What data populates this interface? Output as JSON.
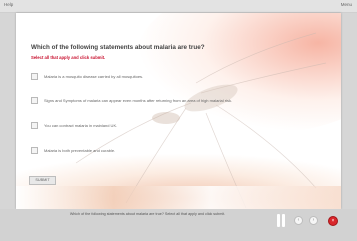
{
  "topbar": {
    "help": "Help",
    "menu": "Menu"
  },
  "quiz": {
    "question": "Which of the following statements about malaria are true?",
    "instruction": "Select all that apply and click submit.",
    "options": [
      {
        "label": "Malaria is a mosquito disease carried by all mosquitoes."
      },
      {
        "label": "Signs and Symptoms of malaria can appear even months after returning from an area of high malarial risk."
      },
      {
        "label": "You can contract malaria in mainland UK."
      },
      {
        "label": "Malaria is both preventable and curable."
      }
    ],
    "submit_label": "SUBMIT"
  },
  "player": {
    "transcript": "Which of the following statements about malaria are true? Select all that apply and click submit.",
    "prev_icon": "back-icon",
    "next_icon": "forward-icon",
    "close_glyph": "×",
    "colors": {
      "close": "#d9262b",
      "instruction": "#c8102e"
    }
  }
}
